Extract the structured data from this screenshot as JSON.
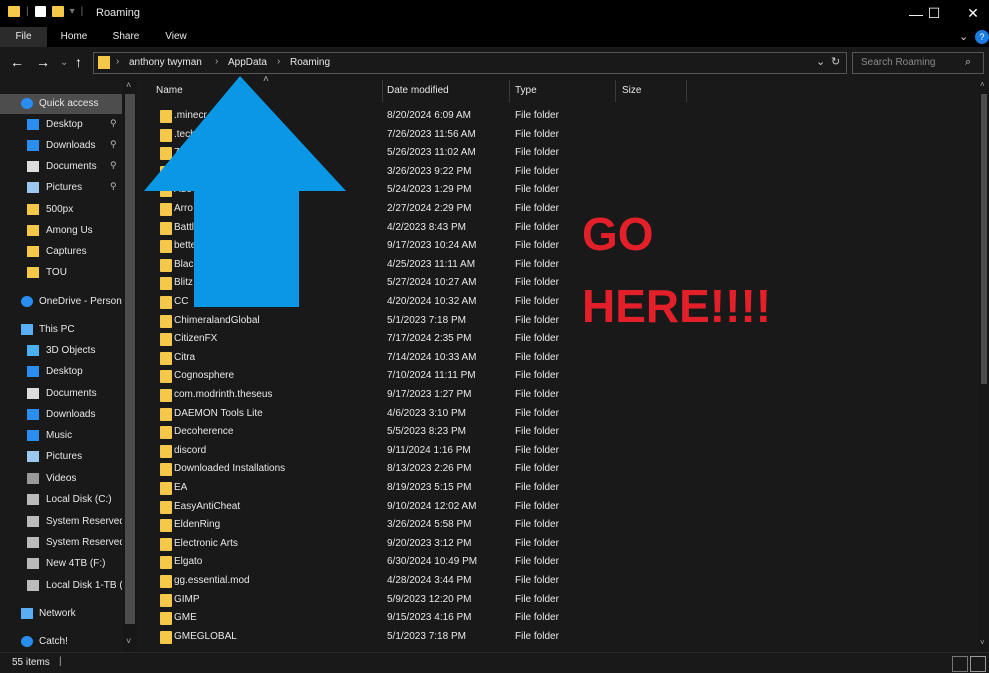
{
  "window": {
    "title": "Roaming",
    "minimize_icon": "minimize-icon",
    "maximize_icon": "maximize-icon",
    "close_icon": "close-icon"
  },
  "ribbon": {
    "tabs": [
      "File",
      "Home",
      "Share",
      "View"
    ]
  },
  "address": {
    "crumbs": [
      "anthony twyman",
      "AppData",
      "Roaming"
    ]
  },
  "search": {
    "placeholder": "Search Roaming"
  },
  "sidebar": {
    "items": [
      {
        "label": "Quick access",
        "icon": "star-icon"
      },
      {
        "label": "Desktop",
        "icon": "desktop-icon"
      },
      {
        "label": "Downloads",
        "icon": "download-icon"
      },
      {
        "label": "Documents",
        "icon": "documents-icon"
      },
      {
        "label": "Pictures",
        "icon": "pictures-icon"
      },
      {
        "label": "500px",
        "icon": "folder-icon"
      },
      {
        "label": "Among Us",
        "icon": "folder-icon"
      },
      {
        "label": "Captures",
        "icon": "folder-icon"
      },
      {
        "label": "TOU",
        "icon": "folder-icon"
      },
      {
        "label": "OneDrive - Person",
        "icon": "cloud-icon"
      },
      {
        "label": "This PC",
        "icon": "computer-icon"
      },
      {
        "label": "3D Objects",
        "icon": "cube-icon"
      },
      {
        "label": "Desktop",
        "icon": "desktop-icon"
      },
      {
        "label": "Documents",
        "icon": "documents-icon"
      },
      {
        "label": "Downloads",
        "icon": "download-icon"
      },
      {
        "label": "Music",
        "icon": "music-icon"
      },
      {
        "label": "Pictures",
        "icon": "pictures-icon"
      },
      {
        "label": "Videos",
        "icon": "videos-icon"
      },
      {
        "label": "Local Disk (C:)",
        "icon": "disk-icon"
      },
      {
        "label": "System Reserved",
        "icon": "disk-icon"
      },
      {
        "label": "System Reserved",
        "icon": "disk-icon"
      },
      {
        "label": "New 4TB (F:)",
        "icon": "disk-icon"
      },
      {
        "label": "Local Disk 1-TB (",
        "icon": "disk-icon"
      },
      {
        "label": "Network",
        "icon": "network-icon"
      },
      {
        "label": "Catch!",
        "icon": "catch-icon"
      }
    ]
  },
  "columns": {
    "name": "Name",
    "date": "Date modified",
    "type": "Type",
    "size": "Size"
  },
  "files": [
    {
      "name": ".minecr",
      "date": "8/20/2024 6:09 AM",
      "type": "File folder"
    },
    {
      "name": ".tech",
      "date": "7/26/2023 11:56 AM",
      "type": "File folder"
    },
    {
      "name": "7",
      "date": "5/26/2023 11:02 AM",
      "type": "File folder"
    },
    {
      "name": "",
      "date": "3/26/2023 9:22 PM",
      "type": "File folder"
    },
    {
      "name": "Ado",
      "date": "5/24/2023 1:29 PM",
      "type": "File folder"
    },
    {
      "name": "Arro",
      "date": "2/27/2024 2:29 PM",
      "type": "File folder"
    },
    {
      "name": "Battl",
      "date": "4/2/2023 8:43 PM",
      "type": "File folder"
    },
    {
      "name": "bette",
      "date": "9/17/2023 10:24 AM",
      "type": "File folder"
    },
    {
      "name": "Blac",
      "date": "4/25/2023 11:11 AM",
      "type": "File folder"
    },
    {
      "name": "Blitz",
      "date": "5/27/2024 10:27 AM",
      "type": "File folder"
    },
    {
      "name": "CC",
      "date": "4/20/2024 10:32 AM",
      "type": "File folder"
    },
    {
      "name": "ChimeralandGlobal",
      "date": "5/1/2023 7:18 PM",
      "type": "File folder"
    },
    {
      "name": "CitizenFX",
      "date": "7/17/2024 2:35 PM",
      "type": "File folder"
    },
    {
      "name": "Citra",
      "date": "7/14/2024 10:33 AM",
      "type": "File folder"
    },
    {
      "name": "Cognosphere",
      "date": "7/10/2024 11:11 PM",
      "type": "File folder"
    },
    {
      "name": "com.modrinth.theseus",
      "date": "9/17/2023 1:27 PM",
      "type": "File folder"
    },
    {
      "name": "DAEMON Tools Lite",
      "date": "4/6/2023 3:10 PM",
      "type": "File folder"
    },
    {
      "name": "Decoherence",
      "date": "5/5/2023 8:23 PM",
      "type": "File folder"
    },
    {
      "name": "discord",
      "date": "9/11/2024 1:16 PM",
      "type": "File folder"
    },
    {
      "name": "Downloaded Installations",
      "date": "8/13/2023 2:26 PM",
      "type": "File folder"
    },
    {
      "name": "EA",
      "date": "8/19/2023 5:15 PM",
      "type": "File folder"
    },
    {
      "name": "EasyAntiCheat",
      "date": "9/10/2024 12:02 AM",
      "type": "File folder"
    },
    {
      "name": "EldenRing",
      "date": "3/26/2024 5:58 PM",
      "type": "File folder"
    },
    {
      "name": "Electronic Arts",
      "date": "9/20/2023 3:12 PM",
      "type": "File folder"
    },
    {
      "name": "Elgato",
      "date": "6/30/2024 10:49 PM",
      "type": "File folder"
    },
    {
      "name": "gg.essential.mod",
      "date": "4/28/2024 3:44 PM",
      "type": "File folder"
    },
    {
      "name": "GIMP",
      "date": "5/9/2023 12:20 PM",
      "type": "File folder"
    },
    {
      "name": "GME",
      "date": "9/15/2023 4:16 PM",
      "type": "File folder"
    },
    {
      "name": "GMEGLOBAL",
      "date": "5/1/2023 7:18 PM",
      "type": "File folder"
    }
  ],
  "status": {
    "count": "55 items"
  },
  "annotation": {
    "line1": "GO",
    "line2": "HERE!!!!",
    "color": "#e3202a",
    "arrow_color": "#0a98e6"
  }
}
